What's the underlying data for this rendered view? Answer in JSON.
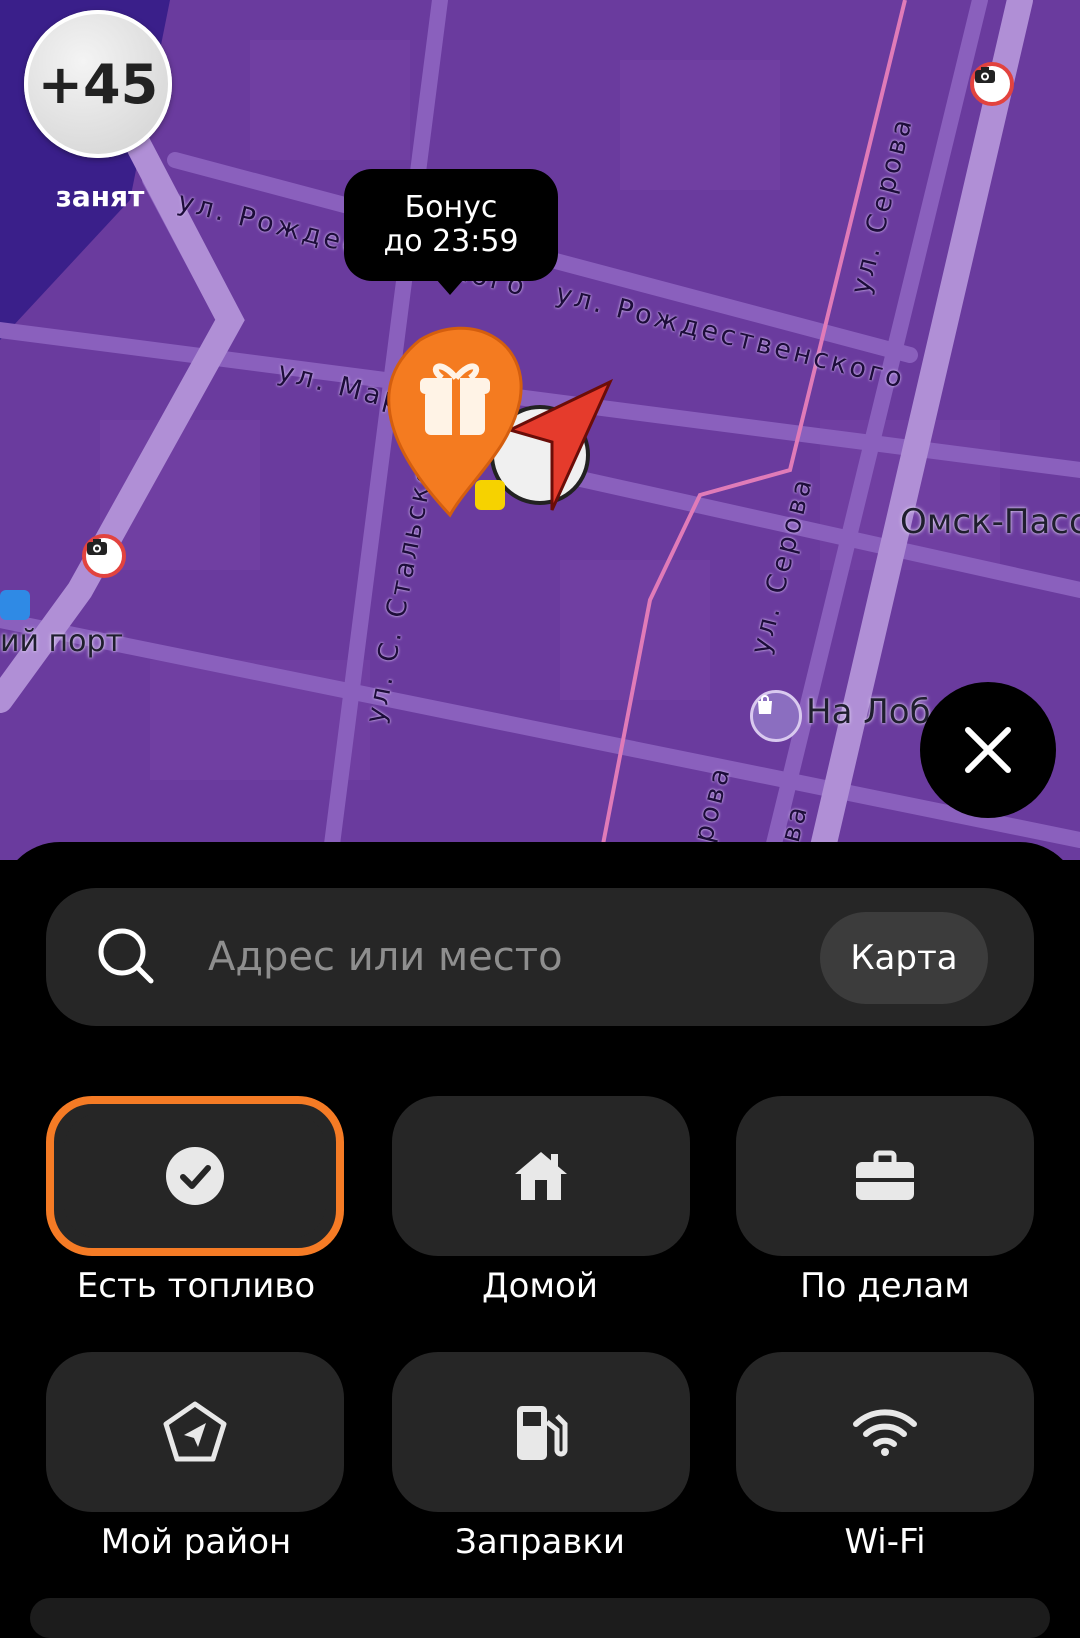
{
  "map": {
    "balance": "+45",
    "status": "занят",
    "bonus_tooltip": {
      "line1": "Бонус",
      "line2": "до 23:59"
    },
    "streets": [
      "ул. Рождественского",
      "ул. Рождественского",
      "ул. Мар",
      "ул. С. Стальского",
      "ул. Серова",
      "ул. Серова",
      "рова",
      "ва"
    ],
    "pois": [
      "Омск-Пасс",
      "ий порт",
      "На Лоб"
    ],
    "icons": [
      "camera-icon",
      "gift-pin-icon",
      "navigation-arrow-icon",
      "shopping-bag-icon",
      "close-icon"
    ]
  },
  "search": {
    "placeholder": "Адрес или место",
    "map_button": "Карта"
  },
  "shortcuts": [
    {
      "label": "Есть топливо",
      "icon": "check-circle-icon",
      "selected": true
    },
    {
      "label": "Домой",
      "icon": "home-icon",
      "selected": false
    },
    {
      "label": "По делам",
      "icon": "briefcase-icon",
      "selected": false
    },
    {
      "label": "Мой район",
      "icon": "my-district-icon",
      "selected": false
    },
    {
      "label": "Заправки",
      "icon": "fuel-pump-icon",
      "selected": false
    },
    {
      "label": "Wi-Fi",
      "icon": "wifi-icon",
      "selected": false
    }
  ],
  "colors": {
    "map_bg": "#6a3b9e",
    "selected_border": "#f57b25",
    "tile_bg": "#262626",
    "sheet_bg": "#000000"
  }
}
